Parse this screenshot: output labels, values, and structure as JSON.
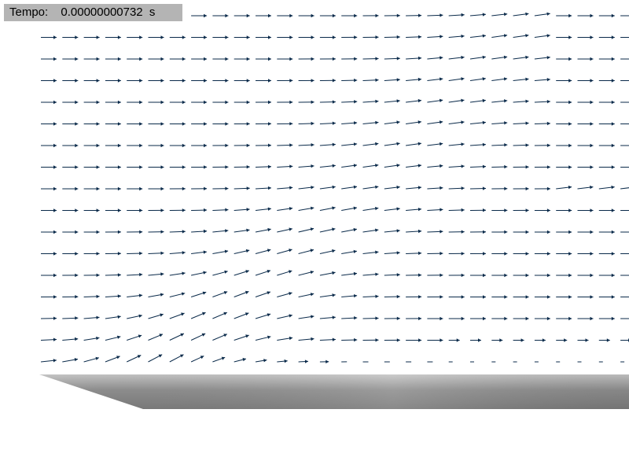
{
  "readout": {
    "label": "Tempo:",
    "value": "0.00000000732",
    "unit": "s"
  },
  "colors": {
    "background": "#ffffff",
    "readout_bg": "#b4b4b4",
    "arrow": "#0a2a4a",
    "surface_light": "#b8b8b8",
    "surface_dark": "#6e6e6e"
  },
  "field": {
    "rows": 17,
    "cols": 28,
    "description_of_flow": "uniform rightward flow with slight upward deflection near a bottom step"
  }
}
